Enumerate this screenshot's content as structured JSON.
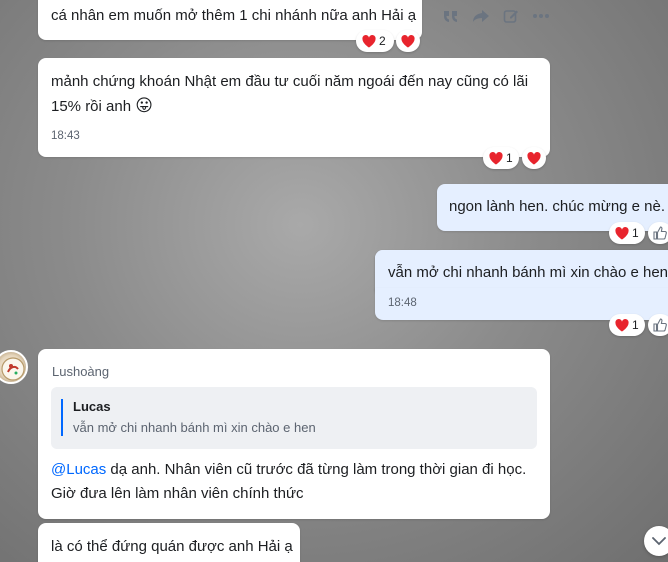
{
  "messages": [
    {
      "text": "cá nhân em muốn mở thêm 1 chi nhánh nữa anh Hải ạ",
      "reaction_count": "2"
    },
    {
      "text": "mảnh chứng khoán Nhật  em đầu tư cuối năm ngoái đến nay cũng có lãi 15% rồi anh",
      "emoji": "😛",
      "time": "18:43",
      "reaction_count": "1"
    },
    {
      "text": "ngon lành hen. chúc mừng e nè.",
      "reaction_count": "1"
    },
    {
      "text": "vẫn mở chi nhanh bánh mì xin chào e hen",
      "time": "18:48",
      "reaction_count": "1"
    },
    {
      "sender": "Lushoàng",
      "quote_author": "Lucas",
      "quote_text": "vẫn mở chi nhanh bánh mì xin chào e hen",
      "mention": "@Lucas",
      "text_after_mention": " dạ anh. Nhân viên cũ trước đã từng làm trong thời gian đi học.",
      "text_line2": "Giờ đưa lên làm nhân viên chính thức"
    },
    {
      "text": "là có thể đứng quán được anh Hải ạ"
    }
  ],
  "toolbar": {
    "icons": [
      "quote-icon",
      "share-icon",
      "edit-icon",
      "more-icon"
    ]
  },
  "colors": {
    "mine_bubble": "#e5efff",
    "other_bubble": "#ffffff",
    "accent": "#0068ff",
    "heart": "#e8242d"
  }
}
